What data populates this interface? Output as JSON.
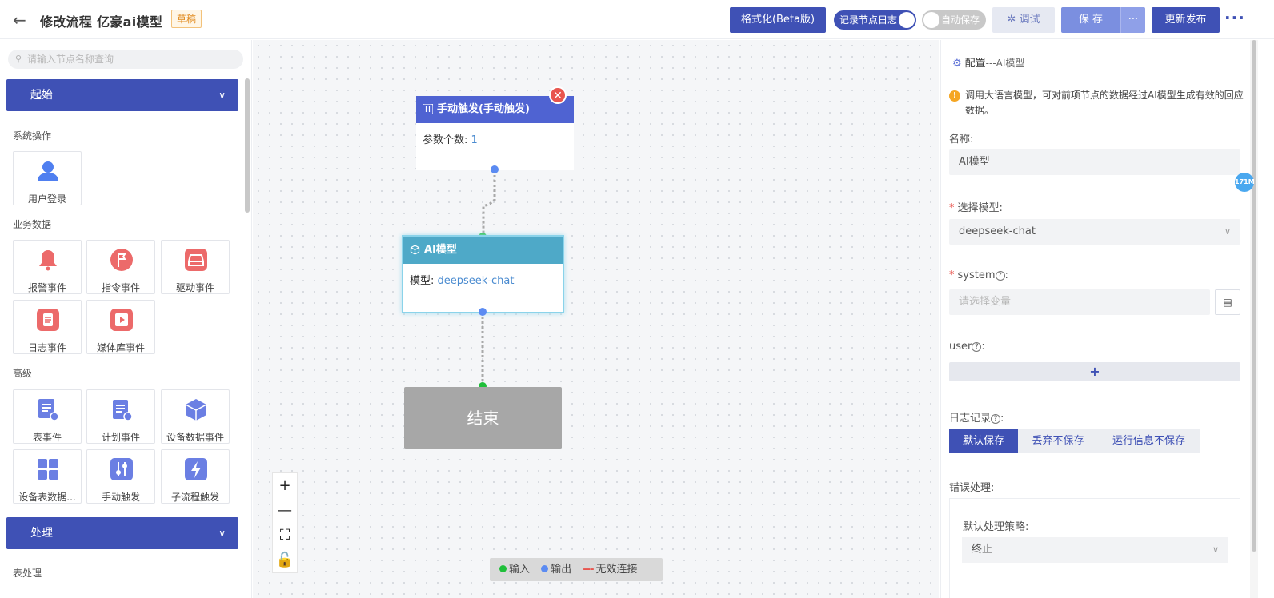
{
  "header": {
    "title": "修改流程 亿豪ai模型",
    "badge": "草稿",
    "format_btn": "格式化(Beta版)",
    "record_log": "记录节点日志",
    "auto_save": "自动保存",
    "debug_btn": "调试",
    "save_btn": "保 存",
    "save_more": "···",
    "publish_btn": "更新发布"
  },
  "sidebar": {
    "search_placeholder": "请输入节点名称查询",
    "section_start": "起始",
    "section_process": "处理",
    "groups": {
      "system": "系统操作",
      "business": "业务数据",
      "advanced": "高级",
      "table": "表处理"
    },
    "cards": {
      "user_login": "用户登录",
      "alarm": "报警事件",
      "command": "指令事件",
      "driver": "驱动事件",
      "log": "日志事件",
      "media": "媒体库事件",
      "table_event": "表事件",
      "plan_event": "计划事件",
      "device_data": "设备数据事件",
      "device_table": "设备表数据...",
      "manual_trigger": "手动触发",
      "subflow_trigger": "子流程触发"
    }
  },
  "canvas": {
    "trigger_node": {
      "title": "手动触发(手动触发)",
      "label": "参数个数:",
      "value": "1"
    },
    "ai_node": {
      "title": "AI模型",
      "label": "模型:",
      "value": "deepseek-chat"
    },
    "end_node": {
      "title": "结束"
    },
    "legend": {
      "input": "输入",
      "output": "输出",
      "invalid": "无效连接",
      "dash": "---"
    },
    "zoom": {
      "in": "+",
      "out": "—"
    }
  },
  "config": {
    "title": "配置",
    "subtitle": "---AI模型",
    "tip": "调用大语言模型，可对前项节点的数据经过AI模型生成有效的回应数据。",
    "name_label": "名称:",
    "name_value": "AI模型",
    "model_label": "选择模型:",
    "model_value": "deepseek-chat",
    "system_label": "system",
    "system_placeholder": "请选择变量",
    "user_label": "user",
    "add": "+",
    "log_label": "日志记录",
    "log_options": [
      "默认保存",
      "丢弃不保存",
      "运行信息不保存"
    ],
    "error_label": "错误处理:",
    "error_strategy_label": "默认处理策略:",
    "error_strategy_value": "终止",
    "memory": "171M"
  },
  "colors": {
    "primary": "#3f51b5",
    "ai_node": "#4ea9c8",
    "trigger_node": "#4f63d2",
    "end_node": "#a7a7a7",
    "input_port": "#1fbf3a",
    "output_port": "#5b8bf2"
  }
}
